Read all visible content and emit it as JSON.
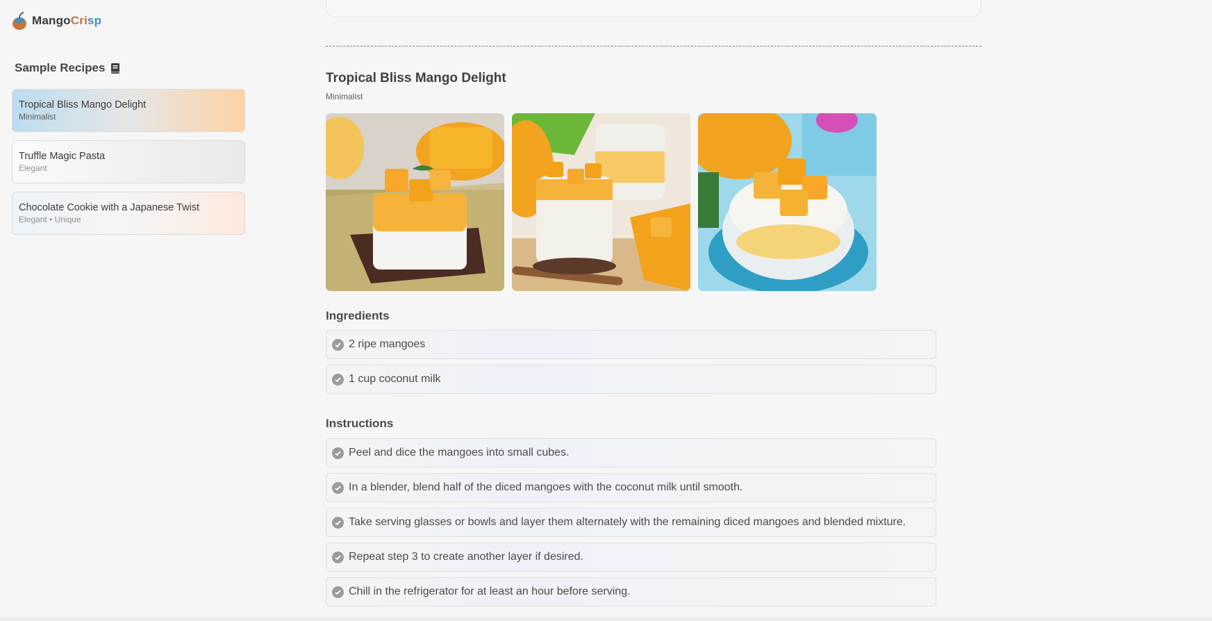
{
  "brand": {
    "name_part1": "Mango",
    "name_part2_c": "Cri",
    "name_part2_blue": "sp"
  },
  "sidebar": {
    "heading": "Sample Recipes",
    "recipes": [
      {
        "title": "Tropical Bliss Mango Delight",
        "tags": "Minimalist"
      },
      {
        "title": "Truffle Magic Pasta",
        "tags": "Elegant"
      },
      {
        "title": "Chocolate Cookie with a Japanese Twist",
        "tags": "Elegant • Unique"
      }
    ]
  },
  "recipe": {
    "title": "Tropical Bliss Mango Delight",
    "style": "Minimalist",
    "ingredients_heading": "Ingredients",
    "ingredients": [
      "2 ripe mangoes",
      "1 cup coconut milk"
    ],
    "instructions_heading": "Instructions",
    "instructions": [
      "Peel and dice the mangoes into small cubes.",
      "In a blender, blend half of the diced mangoes with the coconut milk until smooth.",
      "Take serving glasses or bowls and layer them alternately with the remaining diced mangoes and blended mixture.",
      "Repeat step 3 to create another layer if desired.",
      "Chill in the refrigerator for at least an hour before serving."
    ]
  },
  "icons": {
    "book": "book-icon",
    "check": "check-circle-icon",
    "logo": "mango-logo-icon"
  },
  "colors": {
    "accent_orange": "#c8743a",
    "accent_blue": "#3f8fc4",
    "mango": "#f4a81d"
  }
}
